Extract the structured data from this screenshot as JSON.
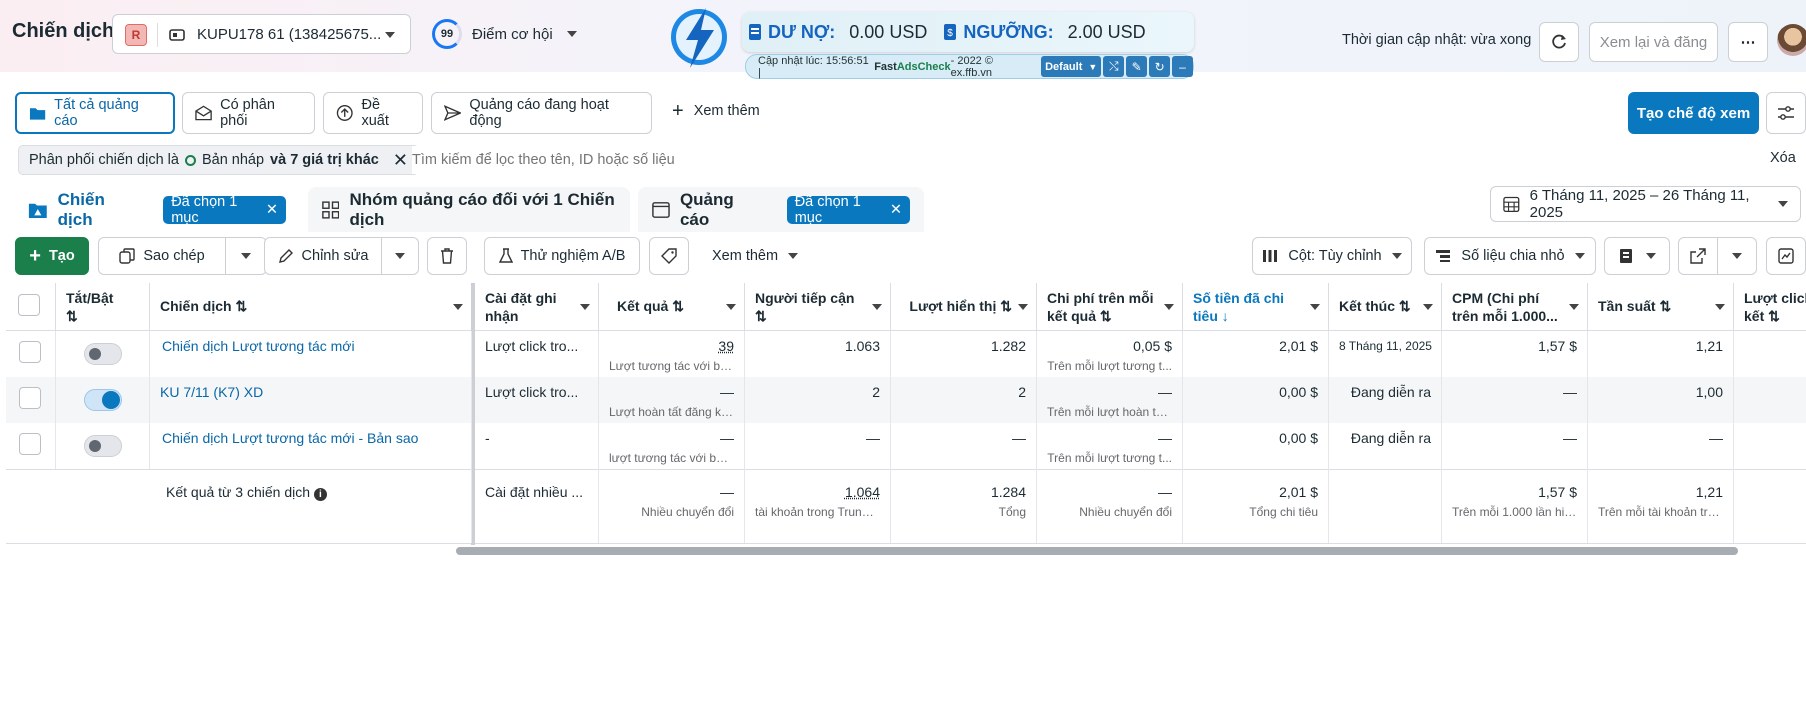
{
  "header": {
    "title": "Chiến dịch",
    "account_badge": "R",
    "account_name": "KUPU178 61 (138425675...",
    "opportunity_score": "99",
    "opportunity_label": "Điểm cơ hội",
    "update_time": "Thời gian cập nhật: vừa xong",
    "review_publish": "Xem lại và đăng"
  },
  "adscheck": {
    "debt_label": "DƯ NỢ:",
    "debt_value": "0.00 USD",
    "threshold_label": "NGƯỠNG:",
    "threshold_value": "2.00 USD",
    "updated_prefix": "Cập nhật lúc: 15:56:51 | ",
    "fast": "Fast ",
    "brand": "AdsCheck",
    "suffix": " - 2022 © ex.ffb.vn",
    "select": "Default"
  },
  "tabs": {
    "all_ads": "Tất cả quảng cáo",
    "delivery": "Có phân phối",
    "suggest": "Đề xuất",
    "active": "Quảng cáo đang hoạt động",
    "more": "Xem thêm",
    "create_view": "Tạo chế độ xem"
  },
  "filter": {
    "chip_prefix": "Phân phối chiến dịch là",
    "chip_value": "Bản nháp",
    "chip_more": "và 7 giá trị khác",
    "placeholder": "Tìm kiếm để lọc theo tên, ID hoặc số liệu",
    "clear": "Xóa"
  },
  "level_tabs": {
    "campaigns": "Chiến dịch",
    "campaigns_selected": "Đã chọn 1 mục",
    "adsets": "Nhóm quảng cáo đối với 1 Chiến dịch",
    "ads": "Quảng cáo",
    "ads_selected": "Đã chọn 1 mục",
    "date_range": "6 Tháng 11, 2025 – 26 Tháng 11, 2025"
  },
  "toolbar": {
    "create": "Tạo",
    "duplicate": "Sao chép",
    "edit": "Chỉnh sửa",
    "ab_test": "Thử nghiệm A/B",
    "more": "Xem thêm",
    "columns": "Cột: Tùy chỉnh",
    "breakdown": "Số liệu chia nhỏ"
  },
  "table": {
    "headers": [
      "Tắt/Bật",
      "Chiến dịch",
      "Cài đặt ghi nhận",
      "Kết quả",
      "Người tiếp cận",
      "Lượt hiển thị",
      "Chi phí trên mỗi kết quả",
      "Số tiền đã chi tiêu",
      "Kết thúc",
      "CPM (Chi phí trên mỗi 1.000...",
      "Tần suất",
      "Lượt click liên kết"
    ],
    "rows": [
      {
        "name": "Chiến dịch Lượt tương tác mới",
        "attribution": "Lượt click tro...",
        "result": "39",
        "result_sub": "Lượt tương tác với bài...",
        "reach": "1.063",
        "impressions": "1.282",
        "cpr": "0,05 $",
        "cpr_sub": "Trên mỗi lượt tương t...",
        "spent": "2,01 $",
        "end": "8 Tháng 11, 2025",
        "cpm": "1,57 $",
        "freq": "1,21"
      },
      {
        "name": "KU 7/11 (K7) XD",
        "attribution": "Lượt click tro...",
        "result": "—",
        "result_sub": "Lượt hoàn tất đăng ký...",
        "reach": "2",
        "impressions": "2",
        "cpr": "—",
        "cpr_sub": "Trên mỗi lượt hoàn tất...",
        "spent": "0,00 $",
        "end": "Đang diễn ra",
        "cpm": "—",
        "freq": "1,00"
      },
      {
        "name": "Chiến dịch Lượt tương tác mới - Bản sao",
        "attribution": "-",
        "result": "—",
        "result_sub": "lượt tương tác với bài...",
        "reach": "—",
        "impressions": "—",
        "cpr": "—",
        "cpr_sub": "Trên mỗi lượt tương t...",
        "spent": "0,00 $",
        "end": "Đang diễn ra",
        "cpm": "—",
        "freq": "—"
      }
    ],
    "summary": {
      "label": "Kết quả từ 3 chiến dịch",
      "attribution": "Cài đặt nhiều ...",
      "result": "—",
      "result_sub": "Nhiều chuyển đổi",
      "reach": "1.064",
      "reach_sub": "tài khoản trong Trung ...",
      "impressions": "1.284",
      "impressions_sub": "Tổng",
      "cpr": "—",
      "cpr_sub": "Nhiều chuyển đổi",
      "spent": "2,01 $",
      "spent_sub": "Tổng chi tiêu",
      "cpm": "1,57 $",
      "cpm_sub": "Trên mỗi 1.000 lần hiể...",
      "freq": "1,21",
      "freq_sub": "Trên mỗi tài khoản tro..."
    }
  }
}
